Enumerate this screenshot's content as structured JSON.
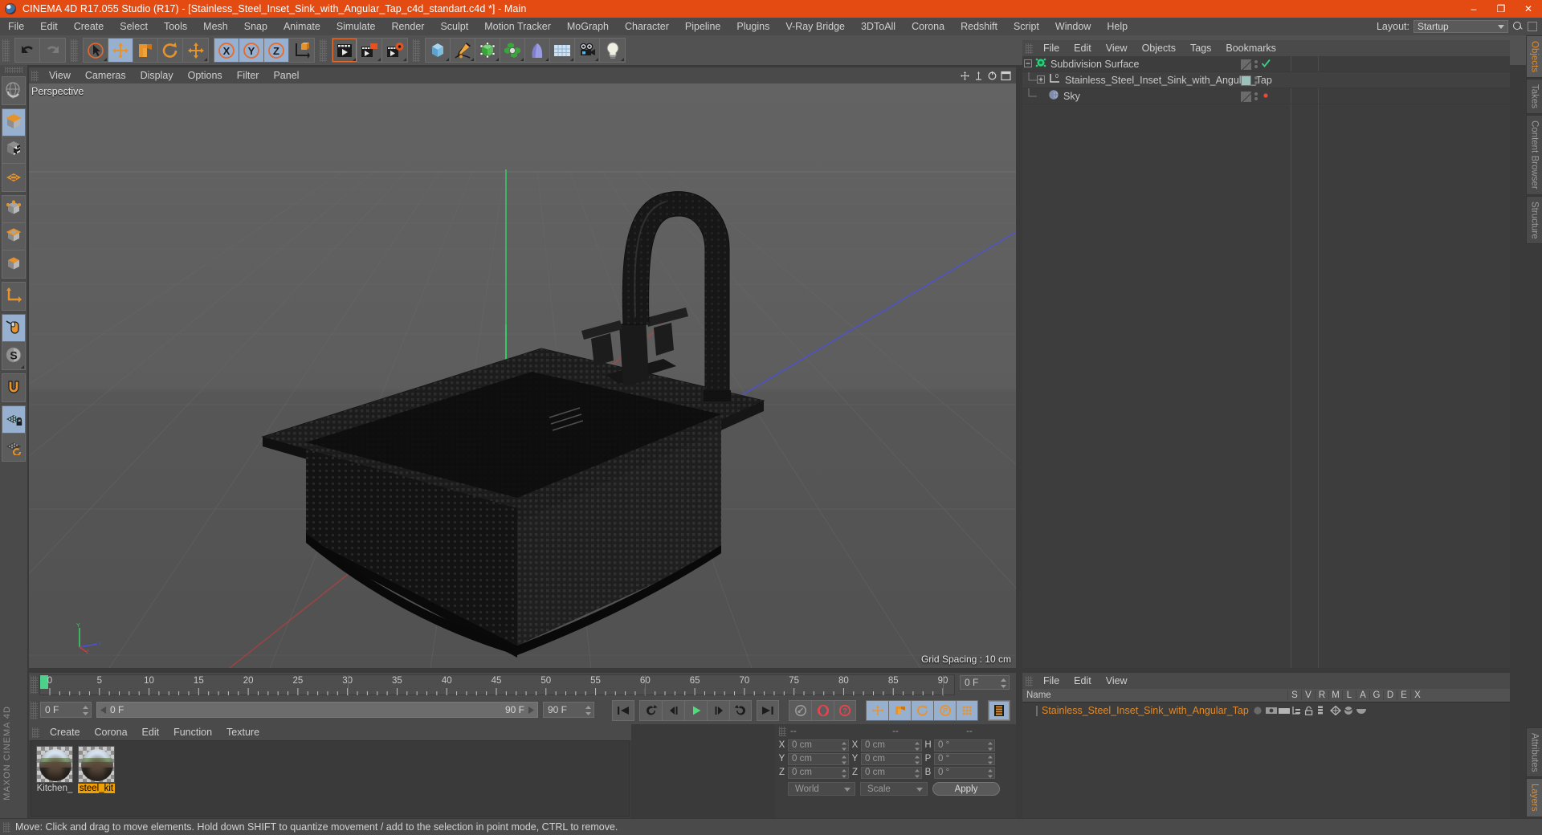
{
  "app": {
    "title": "CINEMA 4D R17.055 Studio (R17) - [Stainless_Steel_Inset_Sink_with_Angular_Tap_c4d_standart.c4d *] - Main",
    "accent": "#e44b12",
    "minimize": "–",
    "maximize": "❐",
    "close": "✕"
  },
  "menubar": {
    "items": [
      "File",
      "Edit",
      "Create",
      "Select",
      "Tools",
      "Mesh",
      "Snap",
      "Animate",
      "Simulate",
      "Render",
      "Sculpt",
      "Motion Tracker",
      "MoGraph",
      "Character",
      "Pipeline",
      "Plugins",
      "V-Ray Bridge",
      "3DToAll",
      "Corona",
      "Redshift",
      "Script",
      "Window",
      "Help"
    ],
    "layout_label": "Layout:",
    "layout_value": "Startup"
  },
  "toolbar": {
    "groups": [
      {
        "buttons": [
          {
            "name": "undo",
            "icon": "undo-icon",
            "state": "normal"
          },
          {
            "name": "redo",
            "icon": "redo-icon",
            "state": "disabled"
          }
        ]
      },
      {
        "buttons": [
          {
            "name": "live-selection",
            "icon": "cursor-select-icon",
            "state": "menu"
          },
          {
            "name": "move",
            "icon": "move-icon",
            "state": "active"
          },
          {
            "name": "scale",
            "icon": "scale-icon",
            "state": "normal"
          },
          {
            "name": "rotate",
            "icon": "rotate-icon",
            "state": "normal"
          },
          {
            "name": "move-dup",
            "icon": "move-icon",
            "state": "menu"
          }
        ]
      },
      {
        "buttons": [
          {
            "name": "x-axis",
            "icon": "x-axis-icon",
            "state": "active"
          },
          {
            "name": "y-axis",
            "icon": "y-axis-icon",
            "state": "active"
          },
          {
            "name": "z-axis",
            "icon": "z-axis-icon",
            "state": "active"
          },
          {
            "name": "world-object-coord",
            "icon": "world-coord-icon",
            "state": "normal"
          }
        ]
      },
      {
        "buttons": [
          {
            "name": "render-view",
            "icon": "render-view-icon",
            "state": "selected"
          },
          {
            "name": "render-region",
            "icon": "render-region-icon",
            "state": "menu"
          },
          {
            "name": "render-settings",
            "icon": "render-settings-icon",
            "state": "menu"
          }
        ]
      },
      {
        "buttons": [
          {
            "name": "add-cube",
            "icon": "cube-icon",
            "state": "menu"
          },
          {
            "name": "add-spline",
            "icon": "pen-spline-icon",
            "state": "menu"
          },
          {
            "name": "add-generator",
            "icon": "generator-icon",
            "state": "menu"
          },
          {
            "name": "add-array",
            "icon": "array-icon",
            "state": "menu"
          },
          {
            "name": "add-deformer",
            "icon": "bend-deformer-icon",
            "state": "menu"
          },
          {
            "name": "add-environment",
            "icon": "floor-grid-icon",
            "state": "menu"
          },
          {
            "name": "add-camera",
            "icon": "camera-icon",
            "state": "menu"
          },
          {
            "name": "add-light",
            "icon": "light-bulb-icon",
            "state": "menu"
          }
        ]
      }
    ]
  },
  "lefttoolbar": {
    "groups": [
      [
        {
          "name": "undo-view",
          "icon": "globe-undo-icon",
          "state": "normal"
        }
      ],
      [
        {
          "name": "model-mode",
          "icon": "model-cube-icon",
          "state": "active"
        },
        {
          "name": "texture-mode",
          "icon": "texture-checker-icon",
          "state": "normal"
        },
        {
          "name": "workplane",
          "icon": "workplane-grid-icon",
          "state": "normal"
        }
      ],
      [
        {
          "name": "points-mode",
          "icon": "points-cube-icon",
          "state": "normal"
        },
        {
          "name": "edges-mode",
          "icon": "edges-cube-icon",
          "state": "normal"
        },
        {
          "name": "polygons-mode",
          "icon": "polygons-cube-icon",
          "state": "normal"
        }
      ],
      [
        {
          "name": "axis-modify",
          "icon": "axis-arrow-icon",
          "state": "normal"
        }
      ],
      [
        {
          "name": "viewport-solo",
          "icon": "mouse-icon",
          "state": "active"
        },
        {
          "name": "snap-settings",
          "icon": "s-snap-icon",
          "state": "menu"
        }
      ],
      [
        {
          "name": "magnet-tool",
          "icon": "magnet-icon",
          "state": "normal"
        }
      ],
      [
        {
          "name": "workplane-lock",
          "icon": "workplane-lock-icon",
          "state": "active"
        },
        {
          "name": "workplane-rotate",
          "icon": "workplane-rotate-icon",
          "state": "normal"
        }
      ]
    ],
    "brand": "MAXON CINEMA 4D"
  },
  "viewport": {
    "menu": [
      "View",
      "Cameras",
      "Display",
      "Options",
      "Filter",
      "Panel"
    ],
    "label": "Perspective",
    "grid_spacing": "Grid Spacing : 10 cm",
    "axis_labels": {
      "y": "Y",
      "x": "X",
      "z": "Z"
    },
    "background": "#5a5a5a",
    "model": "Stainless steel inset sink with angular tap (dark wireframe shaded)"
  },
  "object_manager": {
    "menu": [
      "File",
      "Edit",
      "View",
      "Objects",
      "Tags",
      "Bookmarks"
    ],
    "rows": [
      {
        "name": "Subdivision Surface",
        "icon": "subdivision-surface-icon",
        "indent": 0,
        "selected": false,
        "expander": "minus",
        "visible_dot": "check",
        "tag": "none"
      },
      {
        "name": "Stainless_Steel_Inset_Sink_with_Angular_Tap",
        "icon": "null-object-icon",
        "indent": 1,
        "selected": false,
        "expander": "plus",
        "visible_dot": "none",
        "tag": "material"
      },
      {
        "name": "Sky",
        "icon": "sky-object-icon",
        "indent": 1,
        "selected": false,
        "expander": "none",
        "visible_dot": "red",
        "tag": "none"
      }
    ]
  },
  "right_tabs_top": [
    "Objects",
    "Takes",
    "Content Browser",
    "Structure"
  ],
  "right_tabs_bottom": [
    "Attributes",
    "Layers"
  ],
  "timeline": {
    "ticks": [
      0,
      5,
      10,
      15,
      20,
      25,
      30,
      35,
      40,
      45,
      50,
      55,
      60,
      65,
      70,
      75,
      80,
      85,
      90
    ],
    "current_frame_field": "0 F",
    "start_frame": "0 F",
    "end_frame_slider": "90 F",
    "end_frame_field": "90 F",
    "left_field": "0 F",
    "transport": [
      {
        "name": "go-to-start",
        "icon": "skip-start-icon"
      },
      {
        "name": "previous-key",
        "icon": "prev-key-icon"
      },
      {
        "name": "step-back",
        "icon": "step-back-icon"
      },
      {
        "name": "play",
        "icon": "play-icon"
      },
      {
        "name": "step-forward",
        "icon": "step-forward-icon"
      },
      {
        "name": "next-key",
        "icon": "next-key-icon"
      },
      {
        "name": "go-to-end",
        "icon": "skip-end-icon"
      },
      {
        "name": "record-active-objects",
        "icon": "key-record-icon"
      },
      {
        "name": "autokeying",
        "icon": "autokey-icon"
      },
      {
        "name": "keyframe-selection",
        "icon": "keyframe-select-icon"
      },
      {
        "name": "position-key",
        "icon": "move-key-icon"
      },
      {
        "name": "scale-key",
        "icon": "scale-key-icon"
      },
      {
        "name": "rotation-key",
        "icon": "rotate-key-icon"
      },
      {
        "name": "param-key",
        "icon": "param-key-icon"
      },
      {
        "name": "point-level-anim",
        "icon": "pla-icon"
      },
      {
        "name": "timeline-toggle",
        "icon": "film-strip-icon"
      }
    ]
  },
  "material_manager": {
    "menu": [
      "Create",
      "Corona",
      "Edit",
      "Function",
      "Texture"
    ],
    "materials": [
      {
        "label": "Kitchen_",
        "selected": false
      },
      {
        "label": "steel_kit",
        "selected": true
      }
    ]
  },
  "coordinates": {
    "headers": [
      "--",
      "--",
      "--"
    ],
    "rows": [
      {
        "pos_label": "X",
        "pos_value": "0 cm",
        "size_label": "X",
        "size_value": "0 cm",
        "rot_label": "H",
        "rot_value": "0 °"
      },
      {
        "pos_label": "Y",
        "pos_value": "0 cm",
        "size_label": "Y",
        "size_value": "0 cm",
        "rot_label": "P",
        "rot_value": "0 °"
      },
      {
        "pos_label": "Z",
        "pos_value": "0 cm",
        "size_label": "Z",
        "size_value": "0 cm",
        "rot_label": "B",
        "rot_value": "0 °"
      }
    ],
    "coord_system": "World",
    "mode": "Scale",
    "apply": "Apply"
  },
  "attribute_panel": {
    "menu": [
      "File",
      "Edit",
      "View"
    ],
    "columns": [
      "Name",
      "S",
      "V",
      "R",
      "M",
      "L",
      "A",
      "G",
      "D",
      "E",
      "X"
    ],
    "row_name": "Stainless_Steel_Inset_Sink_with_Angular_Tap",
    "row_color": "#e08a2a"
  },
  "statusbar": {
    "text": "Move: Click and drag to move elements. Hold down SHIFT to quantize movement / add to the selection in point mode, CTRL to remove."
  }
}
